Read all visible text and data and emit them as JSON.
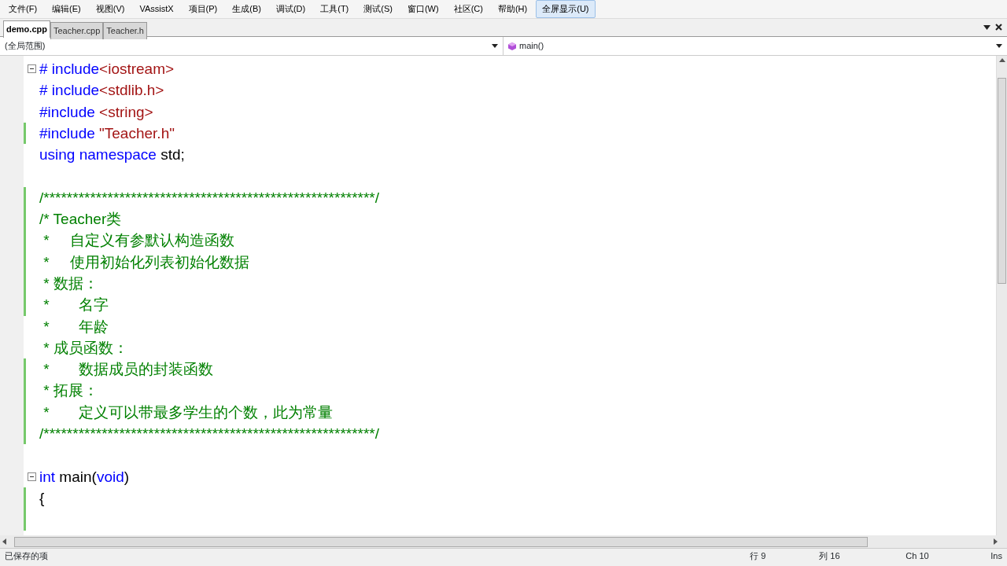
{
  "menu": [
    {
      "label": "文件(F)",
      "selected": false
    },
    {
      "label": "编辑(E)",
      "selected": false
    },
    {
      "label": "视图(V)",
      "selected": false
    },
    {
      "label": "VAssistX",
      "selected": false
    },
    {
      "label": "项目(P)",
      "selected": false
    },
    {
      "label": "生成(B)",
      "selected": false
    },
    {
      "label": "调试(D)",
      "selected": false
    },
    {
      "label": "工具(T)",
      "selected": false
    },
    {
      "label": "测试(S)",
      "selected": false
    },
    {
      "label": "窗口(W)",
      "selected": false
    },
    {
      "label": "社区(C)",
      "selected": false
    },
    {
      "label": "帮助(H)",
      "selected": false
    },
    {
      "label": "全屏显示(U)",
      "selected": true
    }
  ],
  "tabs": [
    {
      "label": "demo.cpp",
      "selected": true
    },
    {
      "label": "Teacher.cpp",
      "selected": false
    },
    {
      "label": "Teacher.h",
      "selected": false
    }
  ],
  "scope": {
    "left": "(全局范围)",
    "right": "main()"
  },
  "lines": [
    {
      "modified": false,
      "fold_box": true,
      "segments": [
        {
          "kind": "kw",
          "text": "# include"
        },
        {
          "kind": "str",
          "text": "<iostream>"
        }
      ]
    },
    {
      "modified": false,
      "fold_box": false,
      "segments": [
        {
          "kind": "kw",
          "text": "# include"
        },
        {
          "kind": "str",
          "text": "<stdlib.h>"
        }
      ]
    },
    {
      "modified": false,
      "fold_box": false,
      "segments": [
        {
          "kind": "kw",
          "text": "#include "
        },
        {
          "kind": "str",
          "text": "<string>"
        }
      ]
    },
    {
      "modified": true,
      "fold_box": false,
      "segments": [
        {
          "kind": "kw",
          "text": "#include "
        },
        {
          "kind": "str",
          "text": "\"Teacher.h\""
        }
      ]
    },
    {
      "modified": false,
      "fold_box": false,
      "segments": [
        {
          "kind": "kw",
          "text": "using namespace"
        },
        {
          "kind": "plain",
          "text": " std;"
        }
      ]
    },
    {
      "modified": false,
      "fold_box": false
    },
    {
      "modified": true,
      "fold_box": false,
      "segments": [
        {
          "kind": "comment",
          "text": "/*********************************************************/"
        }
      ]
    },
    {
      "modified": true,
      "fold_box": false,
      "segments": [
        {
          "kind": "comment",
          "text": "/* Teacher类"
        }
      ]
    },
    {
      "modified": true,
      "fold_box": false,
      "segments": [
        {
          "kind": "comment",
          "text": " *     自定义有参默认构造函数"
        }
      ]
    },
    {
      "modified": true,
      "fold_box": false,
      "segments": [
        {
          "kind": "comment",
          "text": " *     使用初始化列表初始化数据"
        }
      ]
    },
    {
      "modified": true,
      "fold_box": false,
      "segments": [
        {
          "kind": "comment",
          "text": " * 数据："
        }
      ]
    },
    {
      "modified": true,
      "fold_box": false,
      "segments": [
        {
          "kind": "comment",
          "text": " *       名字"
        }
      ]
    },
    {
      "modified": false,
      "fold_box": false,
      "segments": [
        {
          "kind": "comment",
          "text": " *       年龄"
        }
      ]
    },
    {
      "modified": false,
      "fold_box": false,
      "segments": [
        {
          "kind": "comment",
          "text": " * 成员函数："
        }
      ]
    },
    {
      "modified": true,
      "fold_box": false,
      "segments": [
        {
          "kind": "comment",
          "text": " *       数据成员的封装函数"
        }
      ]
    },
    {
      "modified": true,
      "fold_box": false,
      "segments": [
        {
          "kind": "comment",
          "text": " * 拓展："
        }
      ]
    },
    {
      "modified": true,
      "fold_box": false,
      "segments": [
        {
          "kind": "comment",
          "text": " *       定义可以带最多学生的个数，此为常量"
        }
      ]
    },
    {
      "modified": true,
      "fold_box": false,
      "segments": [
        {
          "kind": "comment",
          "text": "/*********************************************************/"
        }
      ]
    },
    {
      "modified": false,
      "fold_box": false
    },
    {
      "modified": false,
      "fold_box": true,
      "segments": [
        {
          "kind": "kw",
          "text": "int"
        },
        {
          "kind": "plain",
          "text": " main("
        },
        {
          "kind": "kw",
          "text": "void"
        },
        {
          "kind": "plain",
          "text": ")"
        }
      ]
    },
    {
      "modified": true,
      "fold_box": false,
      "segments": [
        {
          "kind": "plain",
          "text": "{"
        }
      ]
    },
    {
      "modified": true,
      "fold_box": false
    }
  ],
  "status_bar": {
    "message": "已保存的项",
    "line": "行 9",
    "column": "列 16",
    "char": "Ch 10",
    "mode": "Ins"
  }
}
